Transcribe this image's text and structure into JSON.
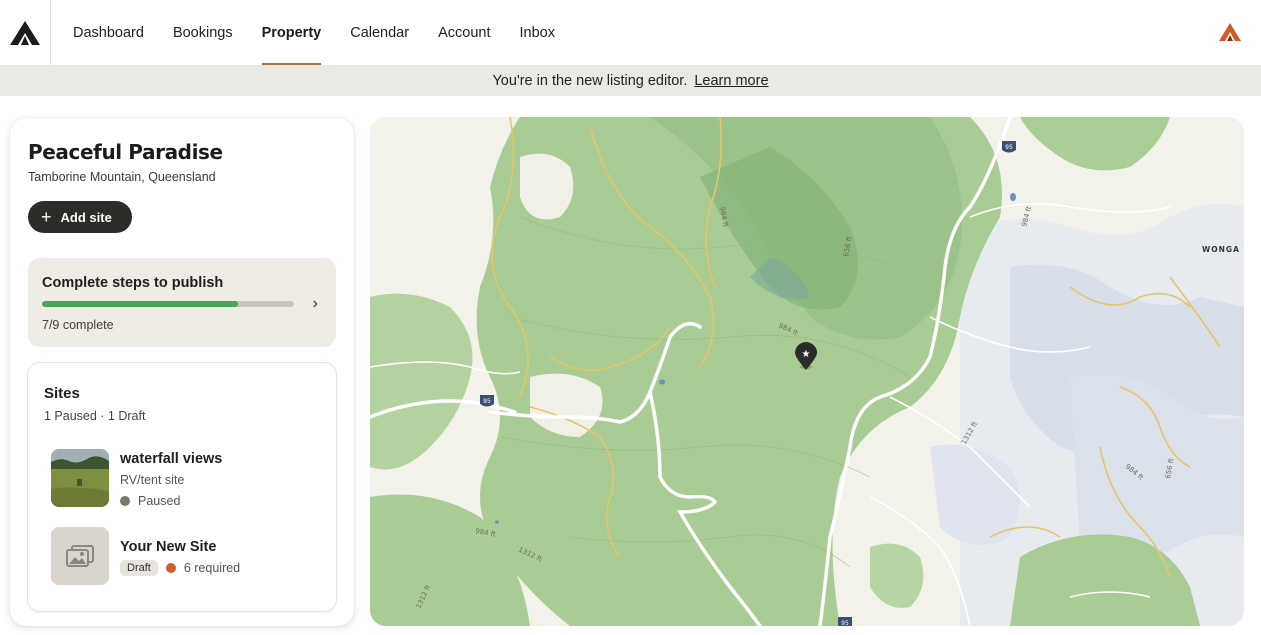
{
  "nav": {
    "items": [
      {
        "label": "Dashboard"
      },
      {
        "label": "Bookings"
      },
      {
        "label": "Property",
        "active": true
      },
      {
        "label": "Calendar"
      },
      {
        "label": "Account"
      },
      {
        "label": "Inbox"
      }
    ]
  },
  "banner": {
    "text": "You're in the new listing editor.",
    "link": "Learn more"
  },
  "property": {
    "name": "Peaceful Paradise",
    "location": "Tamborine Mountain, Queensland",
    "add_site_label": "Add site"
  },
  "steps": {
    "title": "Complete steps to publish",
    "completed": 7,
    "total": 9,
    "count_text": "7/9 complete"
  },
  "sites": {
    "title": "Sites",
    "summary": "1 Paused · 1 Draft",
    "items": [
      {
        "name": "waterfall views",
        "type": "RV/tent site",
        "status": "Paused"
      },
      {
        "name": "Your New Site",
        "badge": "Draft",
        "status": "6 required"
      }
    ]
  },
  "map": {
    "labels": {
      "elev_1": "984 ft",
      "elev_2": "656 ft",
      "elev_3": "984 ft",
      "elev_4": "984 ft",
      "elev_5": "1312 ft",
      "elev_6": "1312 ft",
      "elev_7": "1312 ft",
      "elev_8": "984 ft",
      "elev_9": "656 ft",
      "elev_10": "984 ft",
      "place": "WONGA",
      "route_1": "95",
      "route_2": "95",
      "route_3": "95"
    }
  },
  "colors": {
    "accent_underline": "#a6744a",
    "progress": "#49a355",
    "paused_dot": "#7a7868",
    "required_dot": "#d45a2b",
    "brand_orange": "#d45a2b"
  }
}
